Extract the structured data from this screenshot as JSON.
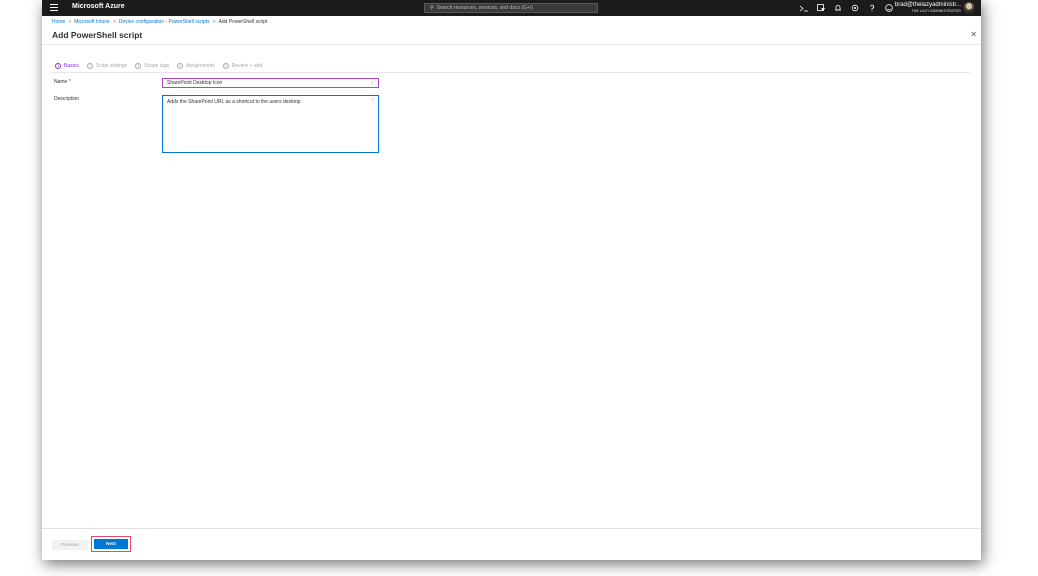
{
  "app": {
    "brand": "Microsoft Azure"
  },
  "search": {
    "placeholder": "Search resources, services, and docs (G+/)"
  },
  "account": {
    "name": "brad@thelazyadministr...",
    "org": "THE LAZY ADMINISTRATOR"
  },
  "breadcrumb": {
    "items": [
      "Home",
      "Microsoft Intune",
      "Device configuration - PowerShell scripts"
    ],
    "current": "Add PowerShell script",
    "separator": ">"
  },
  "page": {
    "title": "Add PowerShell script"
  },
  "steps": [
    {
      "num": "1",
      "label": "Basics"
    },
    {
      "num": "2",
      "label": "Script settings"
    },
    {
      "num": "3",
      "label": "Scope tags"
    },
    {
      "num": "4",
      "label": "Assignments"
    },
    {
      "num": "5",
      "label": "Review + add"
    }
  ],
  "form": {
    "name_label": "Name",
    "required_mark": "*",
    "name_value": "SharePoint Desktop Icon",
    "description_label": "Description",
    "description_value": "Adds the SharePoint URL as a shortcut to the users desktop"
  },
  "footer": {
    "previous": "Previous",
    "next": "Next"
  },
  "colors": {
    "accent": "#0078d4",
    "active_step": "#8a2be2",
    "name_border": "#b146c2",
    "highlight": "#e04a6a"
  },
  "icons": [
    "hamburger-icon",
    "search-icon",
    "cloud-shell-icon",
    "directory-filter-icon",
    "notifications-icon",
    "settings-icon",
    "help-icon",
    "feedback-icon",
    "close-icon",
    "checkmark-icon"
  ]
}
